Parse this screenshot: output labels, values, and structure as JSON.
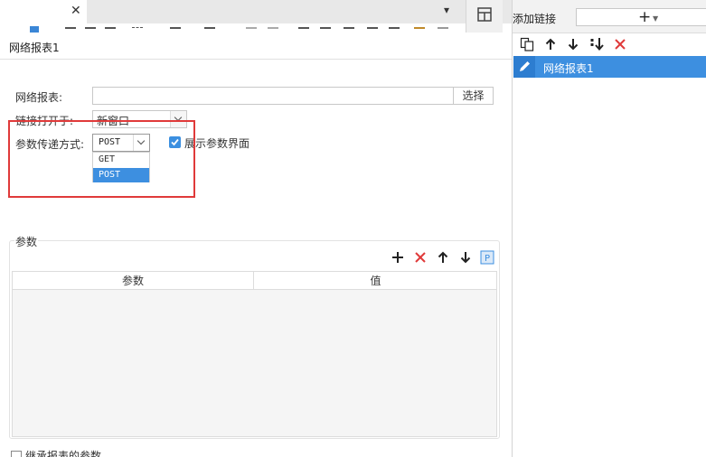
{
  "top_strip": {
    "tab_close": "✕",
    "dropdown_arrow": "▾"
  },
  "dialog": {
    "title": "网络报表1",
    "report_label": "网络报表:",
    "report_value": "",
    "select_button": "选择",
    "open_label": "链接打开于:",
    "open_value": "新窗口",
    "method_label": "参数传递方式:",
    "method_value": "POST",
    "method_options": [
      "GET",
      "POST"
    ],
    "method_selected_option": "POST",
    "show_params_checked": true,
    "show_params_label": "展示参数界面",
    "params_group_label": "参数",
    "params_columns": [
      "参数",
      "值"
    ],
    "inherit_label": "继承报表的参数",
    "inherit_checked": false
  },
  "right_panel": {
    "title": "添加链接",
    "add_symbol": "+",
    "add_caret": "▼",
    "links": [
      "网络报表1"
    ]
  },
  "colors": {
    "accent": "#3d8fe0",
    "highlight_box": "#e03a3a",
    "delete_icon": "#e03a3a"
  }
}
